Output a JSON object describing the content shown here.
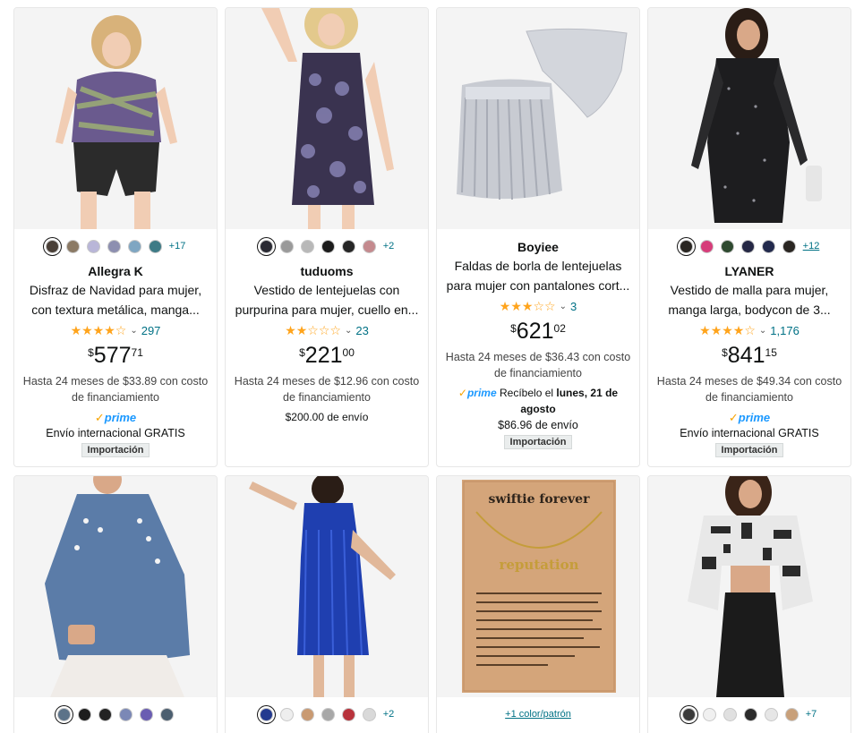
{
  "products": [
    {
      "brand": "Allegra K",
      "title": "Disfraz de Navidad para mujer, con textura metálica, manga...",
      "swatches": [
        "#4a4038",
        "#8b7a65",
        "#b9b6d8",
        "#8d8fb0",
        "#7fa6c2",
        "#3e7b86"
      ],
      "more": "+17",
      "stars": "★★★★☆",
      "rating_count": "297",
      "price": {
        "sym": "$",
        "whole": "577",
        "frac": "71"
      },
      "financing": "Hasta 24 meses de $33.89 con costo de financiamiento",
      "prime": "prime",
      "shipping": "Envío internacional GRATIS",
      "badge": "Importación"
    },
    {
      "brand": "tuduoms",
      "title": "Vestido de lentejuelas con purpurina para mujer, cuello en...",
      "swatches": [
        "#2a2a33",
        "#9a9a9a",
        "#b8b8b8",
        "#1c1c1c",
        "#262626",
        "#c48a8e"
      ],
      "more": "+2",
      "stars": "★★☆☆☆",
      "rating_count": "23",
      "price": {
        "sym": "$",
        "whole": "221",
        "frac": "00"
      },
      "financing": "Hasta 24 meses de $12.96 con costo de financiamiento",
      "shipping_cost": "$200.00 de envío"
    },
    {
      "brand": "Boyiee",
      "title": "Faldas de borla de lentejuelas para mujer con pantalones cort...",
      "stars": "★★★☆☆",
      "rating_count": "3",
      "price": {
        "sym": "$",
        "whole": "621",
        "frac": "02"
      },
      "financing": "Hasta 24 meses de $36.43 con costo de financiamiento",
      "prime": "prime",
      "delivery_prefix": "Recíbelo el",
      "delivery_date": "lunes, 21 de agosto",
      "shipping_cost": "$86.96 de envío",
      "badge": "Importación"
    },
    {
      "brand": "LYANER",
      "title": "Vestido de malla para mujer, manga larga, bodycon de 3...",
      "swatches": [
        "#2a2622",
        "#d63d7a",
        "#2f4a30",
        "#252845",
        "#232a4d",
        "#2a2622"
      ],
      "more": "+12",
      "stars": "★★★★☆",
      "rating_count": "1,176",
      "price": {
        "sym": "$",
        "whole": "841",
        "frac": "15"
      },
      "financing": "Hasta 24 meses de $49.34 con costo de financiamiento",
      "prime": "prime",
      "shipping": "Envío internacional GRATIS",
      "badge": "Importación"
    },
    {
      "swatches": [
        "#5c7389",
        "#1e1e1e",
        "#232323",
        "#7b88b6",
        "#6a5db2",
        "#4c5f70"
      ]
    },
    {
      "swatches": [
        "#233a8f",
        "#eeeeee",
        "#c99a72",
        "#a8a8a8",
        "#b8333c",
        "#d9d9d9"
      ],
      "more": "+2"
    },
    {
      "color_link": "+1 color/patrón",
      "necklace_heading": "swiftie forever",
      "necklace_word": "reputation"
    },
    {
      "swatches": [
        "#3a3a3a",
        "#f0f0f0",
        "#e0e0e0",
        "#2b2b2b",
        "#e6e6e6",
        "#c8a07a"
      ],
      "more": "+7"
    }
  ],
  "colors": {
    "star": "#ffa41c",
    "link": "#007185",
    "prime": "#1a98ff"
  }
}
